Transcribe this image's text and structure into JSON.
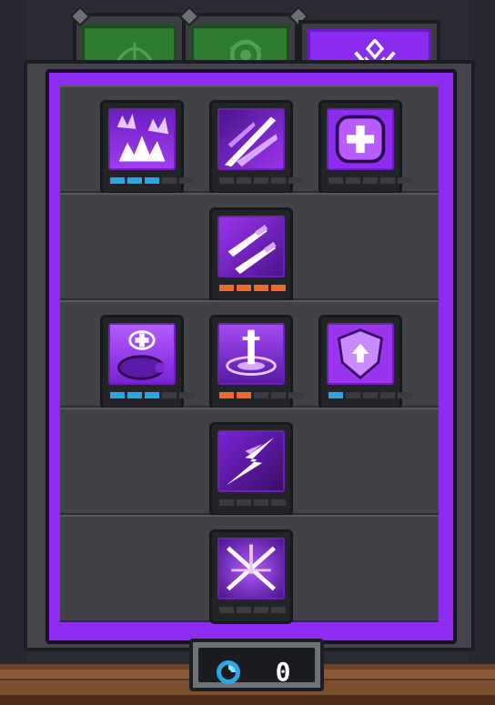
{
  "tabs": [
    {
      "name": "archer",
      "icon": "bow-icon",
      "state": "inactive"
    },
    {
      "name": "mage",
      "icon": "swirl-icon",
      "state": "inactive"
    },
    {
      "name": "paladin",
      "icon": "crest-icon",
      "state": "active"
    }
  ],
  "skill_tree": {
    "rows": [
      [
        {
          "icon": "burst-spikes-icon",
          "level": 3,
          "max": 5,
          "color": "blue"
        },
        {
          "icon": "slash-strike-icon",
          "level": 0,
          "max": 5,
          "color": "blue"
        },
        {
          "icon": "heal-cross-icon",
          "level": 0,
          "max": 5,
          "color": "blue"
        }
      ],
      [
        {
          "icon": "twin-swords-icon",
          "level": 4,
          "max": 4,
          "color": "orange"
        }
      ],
      [
        {
          "icon": "heal-pet-icon",
          "level": 3,
          "max": 5,
          "color": "blue"
        },
        {
          "icon": "sword-aura-icon",
          "level": 2,
          "max": 5,
          "color": "orange"
        },
        {
          "icon": "shield-up-icon",
          "level": 1,
          "max": 5,
          "color": "blue"
        }
      ],
      [
        {
          "icon": "lightning-dash-icon",
          "level": 0,
          "max": 4,
          "color": "orange"
        }
      ],
      [
        {
          "icon": "sword-rain-icon",
          "level": 0,
          "max": 4,
          "color": "orange"
        }
      ]
    ]
  },
  "currency": {
    "icon": "skill-point-gem-icon",
    "amount": "0"
  },
  "colors": {
    "accent": "#8e2cf4",
    "pip_blue": "#28a7e6",
    "pip_orange": "#ef6a2a",
    "tab_green": "#2e7a2e"
  }
}
